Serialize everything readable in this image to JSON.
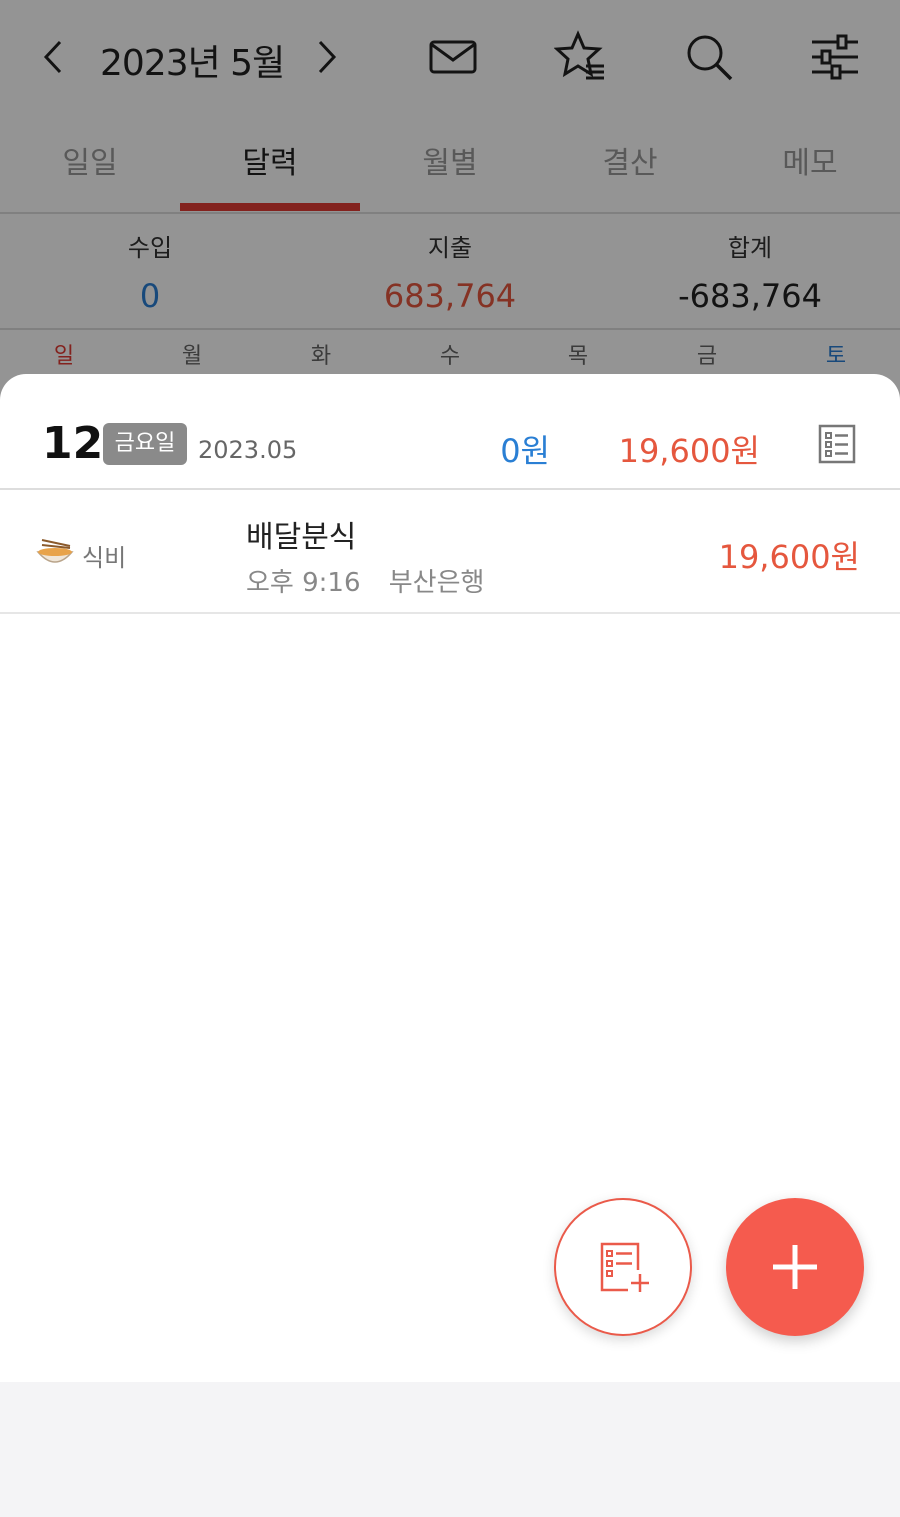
{
  "header": {
    "month_label": "2023년 5월",
    "prev_icon": "chevron-left-icon",
    "next_icon": "chevron-right-icon",
    "icons": [
      "mail-icon",
      "star-list-icon",
      "search-icon",
      "settings-sliders-icon"
    ]
  },
  "tabs": [
    {
      "label": "일일",
      "active": false
    },
    {
      "label": "달력",
      "active": true
    },
    {
      "label": "월별",
      "active": false
    },
    {
      "label": "결산",
      "active": false
    },
    {
      "label": "메모",
      "active": false
    }
  ],
  "summary": {
    "income_label": "수입",
    "income_value": "0",
    "expense_label": "지출",
    "expense_value": "683,764",
    "total_label": "합계",
    "total_value": "-683,764"
  },
  "weekdays": [
    "일",
    "월",
    "화",
    "수",
    "목",
    "금",
    "토"
  ],
  "day_sheet": {
    "day": "12",
    "weekday": "금요일",
    "year_month": "2023.05",
    "income": "0원",
    "expense": "19,600원",
    "list_icon": "list-icon",
    "items": [
      {
        "category_icon": "noodle-bowl-icon",
        "category": "식비",
        "title": "배달분식",
        "time": "오후 9:16",
        "account": "부산은행",
        "amount": "19,600원"
      }
    ]
  },
  "fabs": {
    "add_list_icon": "add-list-icon",
    "add_icon": "plus-icon"
  },
  "colors": {
    "accent": "#e23c34",
    "expense": "#e5573e",
    "income": "#2a7fd4",
    "fab": "#f55b4e"
  }
}
